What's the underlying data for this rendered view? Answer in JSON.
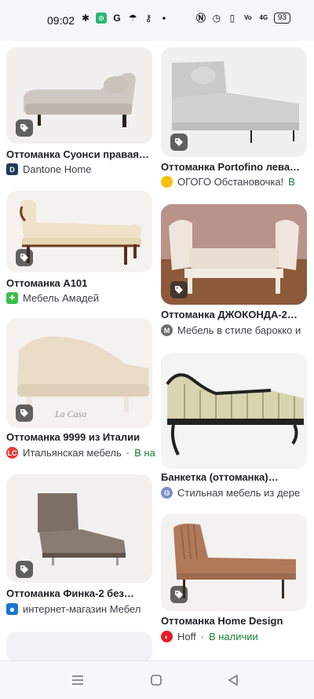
{
  "status_bar": {
    "time": "09:02",
    "battery": "93",
    "icons_left": [
      "settings-gear-icon",
      "app-badge-icon",
      "google-g-icon",
      "umbrella-icon",
      "key-icon",
      "dot-icon"
    ],
    "icons_right": [
      "nfc-icon",
      "alarm-icon",
      "vibrate-icon",
      "volte-icon",
      "signal-4g-icon",
      "battery-icon"
    ]
  },
  "results": {
    "left": [
      {
        "title": "Оттоманка Суонси правая…",
        "source": "Dantone Home",
        "availability": "",
        "source_icon": "D",
        "icon_color": "#1f3b5a"
      },
      {
        "title": "Оттоманка А101",
        "source": "Мебель Амадей",
        "availability": "",
        "source_icon": "puzzle-icon",
        "icon_color": "#3bbf4a"
      },
      {
        "title": "Оттоманка 9999 из Италии",
        "source": "Итальянская мебель",
        "availability": "В на",
        "source_icon": "LC",
        "icon_color": "#e53935"
      },
      {
        "title": "Оттоманка Финка-2 без…",
        "source": "интернет-магазин Мебел",
        "availability": "",
        "source_icon": "person-icon",
        "icon_color": "#1976d2"
      }
    ],
    "right": [
      {
        "title": "Оттоманка Portofino лева…",
        "source": "ОГОГО Обстановочка!",
        "availability": "В",
        "source_icon": "circle",
        "icon_color": "#f4c20d"
      },
      {
        "title": "Оттоманка ДЖОКОНДА-2…",
        "source": "Мебель в стиле барокко и",
        "availability": "",
        "source_icon": "M",
        "icon_color": "#6d6d6d"
      },
      {
        "title": "Банкетка (оттоманка)…",
        "source": "Стильная мебель из дере",
        "availability": "",
        "source_icon": "globe-icon",
        "icon_color": "#7a8fc4"
      },
      {
        "title": "Оттоманка Home Design",
        "source": "Hoff",
        "availability": "В наличии",
        "source_icon": "hoff-icon",
        "icon_color": "#e31e24"
      }
    ]
  },
  "colors": {
    "availability": "#188038",
    "card_bg": "#f2f2f4",
    "text": "#202124"
  },
  "nav": {
    "items": [
      "menu-icon",
      "home-square-icon",
      "back-triangle-icon"
    ]
  }
}
